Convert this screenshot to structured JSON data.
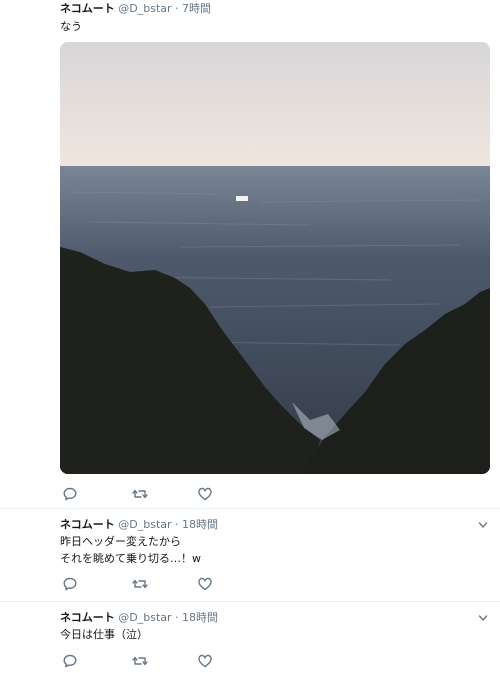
{
  "tweets": [
    {
      "name": "ネコムート",
      "handle": "@D_bstar",
      "dot": "·",
      "time": "7時間",
      "text": "なう",
      "has_photo": true,
      "has_caret": false
    },
    {
      "name": "ネコムート",
      "handle": "@D_bstar",
      "dot": "·",
      "time": "18時間",
      "text_line1": "昨日ヘッダー変えたから",
      "text_line2": "それを眺めて乗り切る…！w",
      "has_photo": false,
      "has_caret": true
    },
    {
      "name": "ネコムート",
      "handle": "@D_bstar",
      "dot": "·",
      "time": "18時間",
      "text": "今日は仕事（泣）",
      "has_photo": false,
      "has_caret": true
    }
  ],
  "icons": {
    "reply": "reply-icon",
    "retweet": "retweet-icon",
    "like": "heart-icon",
    "caret": "chevron-down-icon"
  },
  "colors": {
    "text": "#14171a",
    "muted": "#657786",
    "icon": "#657786",
    "separator": "#e6ecf0"
  }
}
